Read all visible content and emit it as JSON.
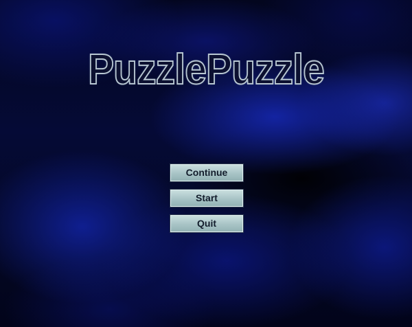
{
  "title": "PuzzlePuzzle",
  "menu": {
    "continue_label": "Continue",
    "start_label": "Start",
    "quit_label": "Quit"
  },
  "colors": {
    "background": "#050a36",
    "title_outline": "#b8c7d2",
    "button_face": "#a8c4c6",
    "button_text": "#131d2c"
  }
}
